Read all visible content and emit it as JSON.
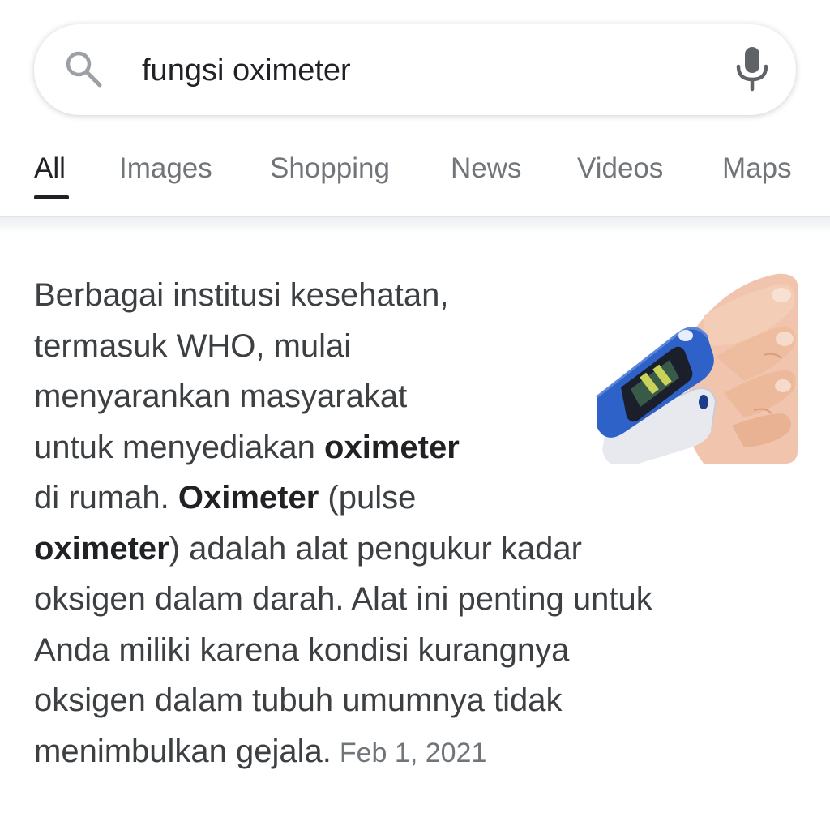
{
  "search": {
    "query": "fungsi oximeter"
  },
  "tabs": [
    {
      "label": "All",
      "active": true
    },
    {
      "label": "Images",
      "active": false
    },
    {
      "label": "Shopping",
      "active": false
    },
    {
      "label": "News",
      "active": false
    },
    {
      "label": "Videos",
      "active": false
    },
    {
      "label": "Maps",
      "active": false
    }
  ],
  "snippet": {
    "lines": [
      [
        "Berbagai institusi kesehatan,"
      ],
      [
        "termasuk WHO, mulai"
      ],
      [
        "menyarankan masyarakat"
      ],
      [
        "untuk menyediakan ",
        "oximeter"
      ],
      [
        "di rumah. ",
        "Oximeter",
        " (pulse"
      ],
      [
        "oximeter",
        ") adalah alat pengukur kadar"
      ],
      [
        "oksigen dalam darah. Alat ini penting untuk"
      ],
      [
        "Anda miliki karena kondisi kurangnya"
      ],
      [
        "oksigen dalam tubuh umumnya tidak"
      ],
      [
        "menimbulkan gejala."
      ]
    ],
    "bold_terms": [
      "oximeter",
      "Oximeter"
    ],
    "date": "Feb 1, 2021"
  },
  "image": {
    "alt": "pulse-oximeter-on-finger"
  },
  "colors": {
    "accent_text": "#202124",
    "muted_text": "#70757a",
    "body_text": "#3c4043",
    "device_blue": "#2f62c8"
  }
}
